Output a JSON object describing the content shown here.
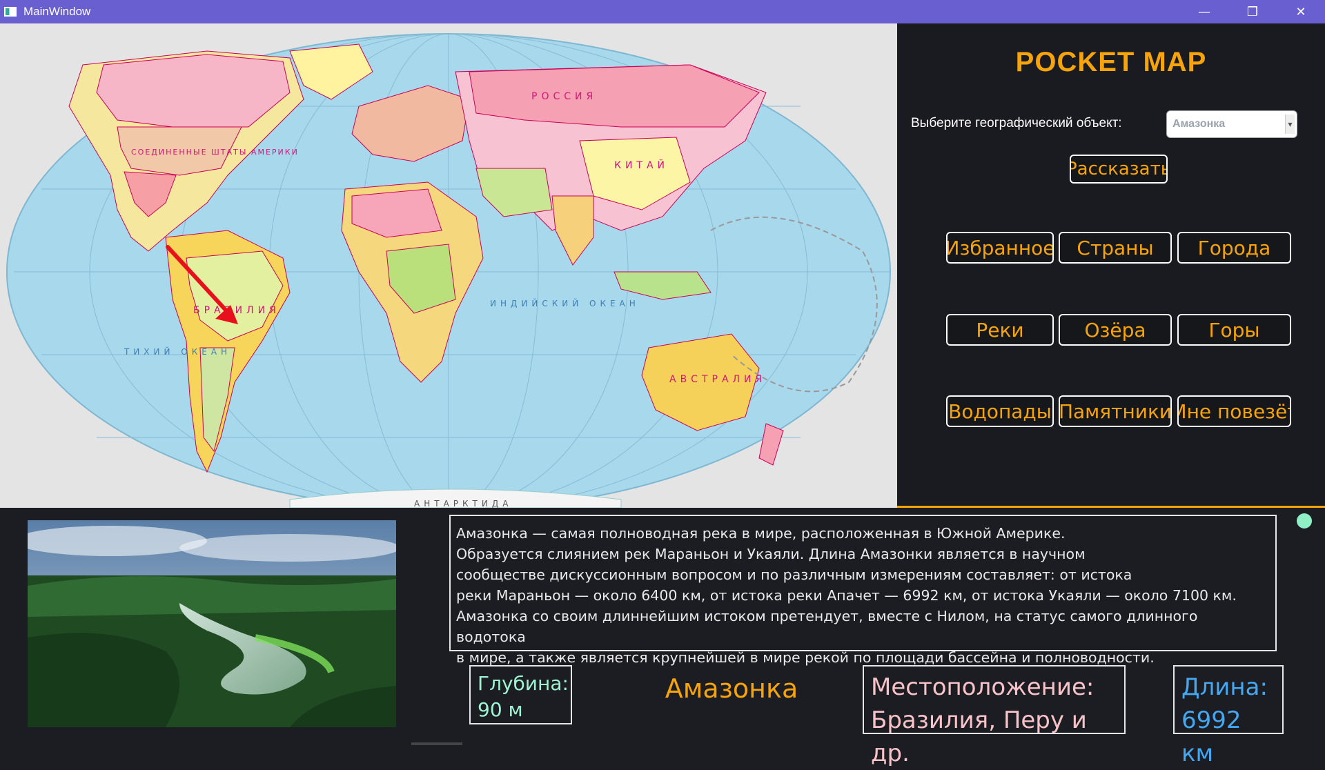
{
  "window": {
    "title": "MainWindow",
    "controls": {
      "minimize": "—",
      "maximize": "❐",
      "close": "✕"
    }
  },
  "map": {
    "labels": {
      "usa": "СОЕДИНЕННЫЕ ШТАТЫ АМЕРИКИ",
      "brazil": "БРАЗИЛИЯ",
      "russia": "РОССИЯ",
      "china": "КИТАЙ",
      "australia": "АВСТРАЛИЯ",
      "indian_ocean": "ИНДИЙСКИЙ ОКЕАН",
      "antarctica": "АНТАРКТИДА",
      "pacific": "ТИХИЙ ОКЕАН"
    },
    "arrow_color": "#e8101c"
  },
  "panel": {
    "app_title": "POCKET MAP",
    "select_label": "Выберите географический объект:",
    "select_value": "Амазонка",
    "tell_button": "Рассказать",
    "categories": [
      "Избранное",
      "Страны",
      "Города",
      "Реки",
      "Озёра",
      "Горы",
      "Водопады",
      "Памятники",
      "Мне повезёт"
    ],
    "accent_color": "#f7a40c"
  },
  "info": {
    "description": "Амазонка — самая полноводная река в мире, расположенная в Южной Америке.\nОбразуется слиянием рек Мараньон и Укаяли. Длина Амазонки является в научном\nсообществе дискуссионным вопросом и по различным измерениям составляет: от истока\nреки Мараньон — около 6400 км, от истока реки Апачет — 6992 км, от истока Укаяли — около 7100 км.\nАмазонка со своим длиннейшим истоком претендует, вместе с Нилом, на статус самого длинного водотока\nв мире, а также является крупнейшей в мире рекой по площади бассейна и полноводности.",
    "depth_label": "Глубина:",
    "depth_value": "90 м",
    "name": "Амазонка",
    "location_label": "Местоположение:",
    "location_value": "Бразилия, Перу и др.",
    "length_label": "Длина:",
    "length_value": "6992 км"
  }
}
